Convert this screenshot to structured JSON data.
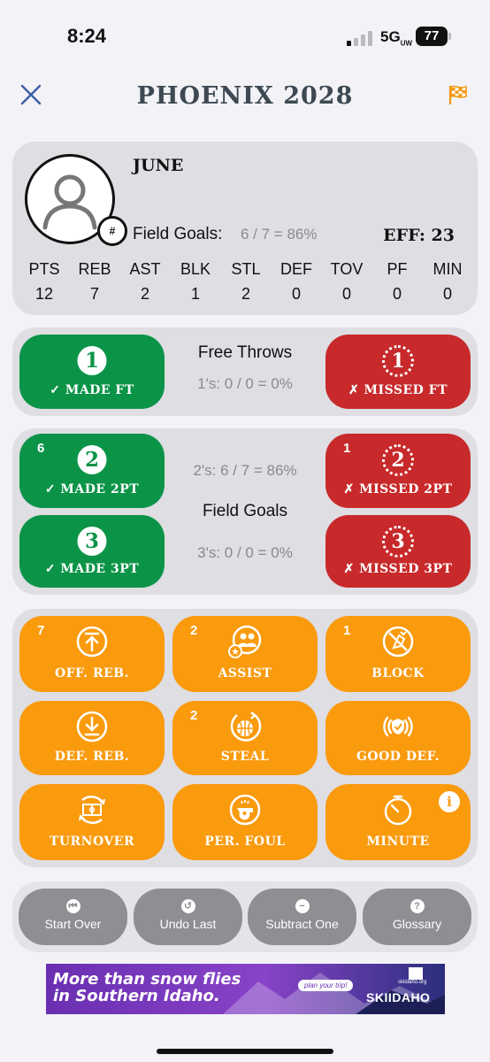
{
  "status": {
    "time": "8:24",
    "network": "5G",
    "network_sub": "UW",
    "battery": "77"
  },
  "header": {
    "title": "PHOENIX 2028"
  },
  "player": {
    "name": "JUNE",
    "jersey": "#",
    "fg_label": "Field Goals:",
    "fg_value": "6 / 7 = 86%",
    "eff": "EFF: 23",
    "stats": [
      {
        "label": "PTS",
        "value": "12"
      },
      {
        "label": "REB",
        "value": "7"
      },
      {
        "label": "AST",
        "value": "2"
      },
      {
        "label": "BLK",
        "value": "1"
      },
      {
        "label": "STL",
        "value": "2"
      },
      {
        "label": "DEF",
        "value": "0"
      },
      {
        "label": "TOV",
        "value": "0"
      },
      {
        "label": "PF",
        "value": "0"
      },
      {
        "label": "MIN",
        "value": "0"
      }
    ]
  },
  "free_throws": {
    "title": "Free Throws",
    "summary": "1's: 0 / 0 = 0%",
    "made": {
      "num": "1",
      "label": "✓ MADE FT"
    },
    "missed": {
      "num": "1",
      "label": "✗ MISSED FT"
    }
  },
  "field_goals": {
    "title": "Field Goals",
    "twos_summary": "2's: 6 / 7 = 86%",
    "threes_summary": "3's: 0 / 0 = 0%",
    "made2": {
      "num": "2",
      "label": "✓ MADE 2PT",
      "count": "6"
    },
    "missed2": {
      "num": "2",
      "label": "✗ MISSED 2PT",
      "count": "1"
    },
    "made3": {
      "num": "3",
      "label": "✓ MADE 3PT"
    },
    "missed3": {
      "num": "3",
      "label": "✗ MISSED 3PT"
    }
  },
  "actions": [
    {
      "label": "OFF. REB.",
      "count": "7",
      "icon": "arrow-up-icon"
    },
    {
      "label": "ASSIST",
      "count": "2",
      "icon": "people-star-icon"
    },
    {
      "label": "BLOCK",
      "count": "1",
      "icon": "block-icon"
    },
    {
      "label": "DEF. REB.",
      "count": "",
      "icon": "arrow-down-icon"
    },
    {
      "label": "STEAL",
      "count": "2",
      "icon": "basketball-icon"
    },
    {
      "label": "GOOD DEF.",
      "count": "",
      "icon": "shield-check-icon"
    },
    {
      "label": "TURNOVER",
      "count": "",
      "icon": "court-icon"
    },
    {
      "label": "PER. FOUL",
      "count": "",
      "icon": "whistle-icon"
    },
    {
      "label": "MINUTE",
      "count": "",
      "icon": "stopwatch-icon"
    }
  ],
  "minute_info": "i",
  "bottom": [
    {
      "label": "Start Over",
      "icon": "start-over-icon",
      "glyph": "⏮"
    },
    {
      "label": "Undo Last",
      "icon": "undo-icon",
      "glyph": "↺"
    },
    {
      "label": "Subtract One",
      "icon": "minus-icon",
      "glyph": "−"
    },
    {
      "label": "Glossary",
      "icon": "question-icon",
      "glyph": "?"
    }
  ],
  "ad": {
    "line1": "More than snow flies",
    "line2": "in Southern Idaho.",
    "cta": "plan your trip!",
    "brand": "SKIIDAHO",
    "url": "skiidaho.org"
  },
  "colors": {
    "green": "#0b9447",
    "red": "#c8292a",
    "orange": "#fa9a0d",
    "panel": "#dedee3",
    "pill": "#8e8e93",
    "flag": "#f59a13"
  }
}
